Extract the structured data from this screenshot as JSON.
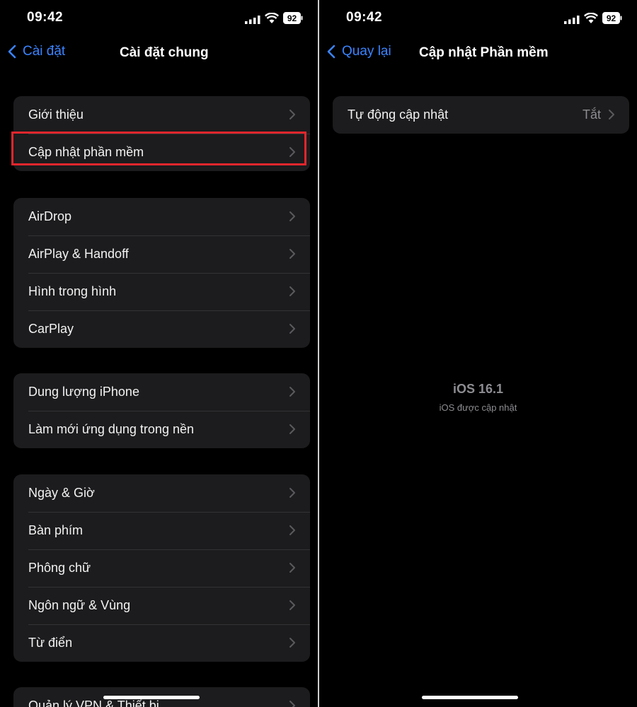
{
  "status_bar": {
    "time": "09:42",
    "battery": "92"
  },
  "left": {
    "back_label": "Cài đặt",
    "title": "Cài đặt chung",
    "groups": [
      [
        "Giới thiệu",
        "Cập nhật phần mềm"
      ],
      [
        "AirDrop",
        "AirPlay & Handoff",
        "Hình trong hình",
        "CarPlay"
      ],
      [
        "Dung lượng iPhone",
        "Làm mới ứng dụng trong nền"
      ],
      [
        "Ngày & Giờ",
        "Bàn phím",
        "Phông chữ",
        "Ngôn ngữ & Vùng",
        "Từ điển"
      ],
      [
        "Quản lý VPN & Thiết bị"
      ]
    ],
    "highlighted_item": "Cập nhật phần mềm",
    "highlight_color": "#e0262c"
  },
  "right": {
    "back_label": "Quay lại",
    "title": "Cập nhật Phần mềm",
    "auto_update": {
      "label": "Tự động cập nhật",
      "value": "Tắt"
    },
    "version": "iOS 16.1",
    "version_status": "iOS được cập nhật"
  },
  "colors": {
    "accent": "#3a84ff",
    "cell_bg": "#1c1c1e",
    "secondary_text": "#8d8d92"
  }
}
